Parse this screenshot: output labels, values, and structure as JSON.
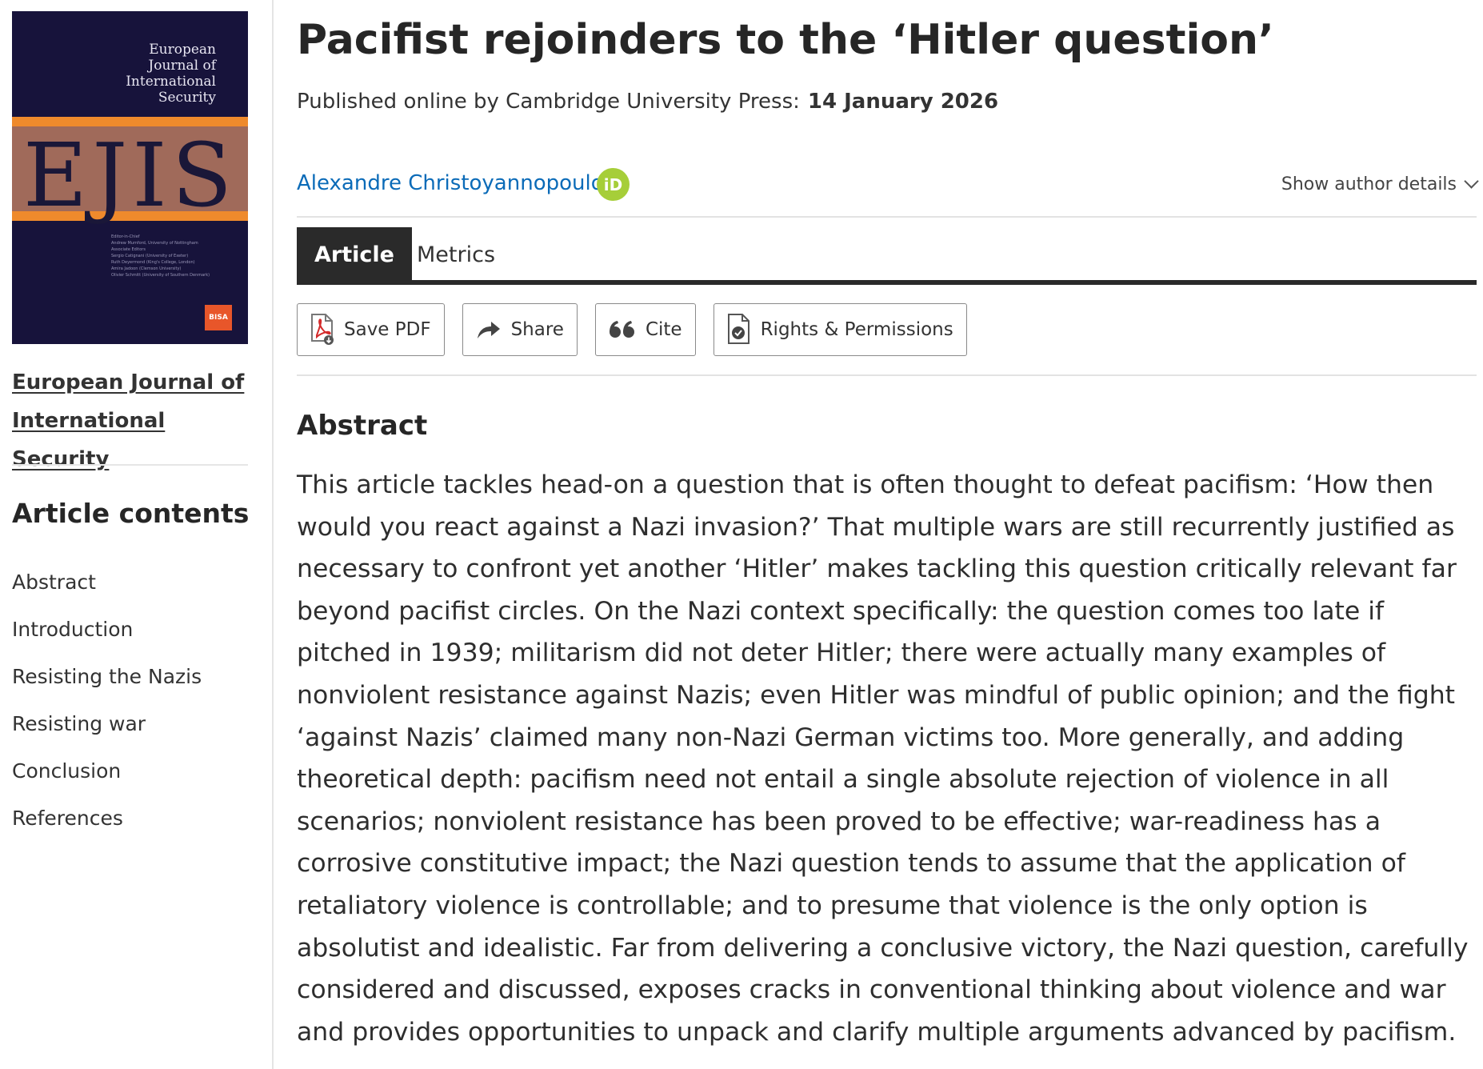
{
  "sidebar": {
    "cover": {
      "title": "European Journal of International Security",
      "logo": "EJIS",
      "small_print": "Editor-in-Chief\nAndrew Mumford, University of Nottingham\nAssociate Editors\nSergio Catignani (University of Exeter)\nRuth Deyermond (King's College, London)\nAmira Jadoon (Clemson University)\nOlivier Schmitt (University of Southern Denmark)",
      "badge": "BISA",
      "colors": {
        "background": "#17133b",
        "band": "#a06a5a",
        "stripe": "#ef8a2c"
      }
    },
    "journal_link": "European Journal of International Security",
    "contents_title": "Article contents",
    "contents": [
      "Abstract",
      "Introduction",
      "Resisting the Nazis",
      "Resisting war",
      "Conclusion",
      "References"
    ]
  },
  "article": {
    "title": "Pacifist rejoinders to the ‘Hitler question’",
    "published_label": "Published online by Cambridge University Press:",
    "published_date": "14 January 2026",
    "author": "Alexandre Christoyannopoulos",
    "orcid_icon": "iD",
    "show_author_details": "Show author details"
  },
  "tabs": [
    {
      "label": "Article",
      "active": true
    },
    {
      "label": "Metrics",
      "active": false
    }
  ],
  "actions": {
    "save_pdf": "Save PDF",
    "share": "Share",
    "cite": "Cite",
    "rights": "Rights & Permissions"
  },
  "abstract": {
    "heading": "Abstract",
    "text": "This article tackles head-on a question that is often thought to defeat pacifism: ‘How then would you react against a Nazi invasion?’ That multiple wars are still recurrently justified as necessary to confront yet another ‘Hitler’ makes tackling this question critically relevant far beyond pacifist circles. On the Nazi context specifically: the question comes too late if pitched in 1939; militarism did not deter Hitler; there were actually many examples of nonviolent resistance against Nazis; even Hitler was mindful of public opinion; and the fight ‘against Nazis’ claimed many non-Nazi German victims too. More generally, and adding theoretical depth: pacifism need not entail a single absolute rejection of violence in all scenarios; nonviolent resistance has been proved to be effective; war-readiness has a corrosive constitutive impact; the Nazi question tends to assume that the application of retaliatory violence is controllable; and to presume that violence is the only option is absolutist and idealistic. Far from delivering a conclusive victory, the Nazi question, carefully considered and discussed, exposes cracks in conventional thinking about violence and war and provides opportunities to unpack and clarify multiple arguments advanced by pacifism."
  },
  "colors": {
    "link": "#0b6bb8",
    "orcid": "#a6ce39",
    "tab_active": "#2a2a2a",
    "pdf_red": "#d42b2b"
  }
}
